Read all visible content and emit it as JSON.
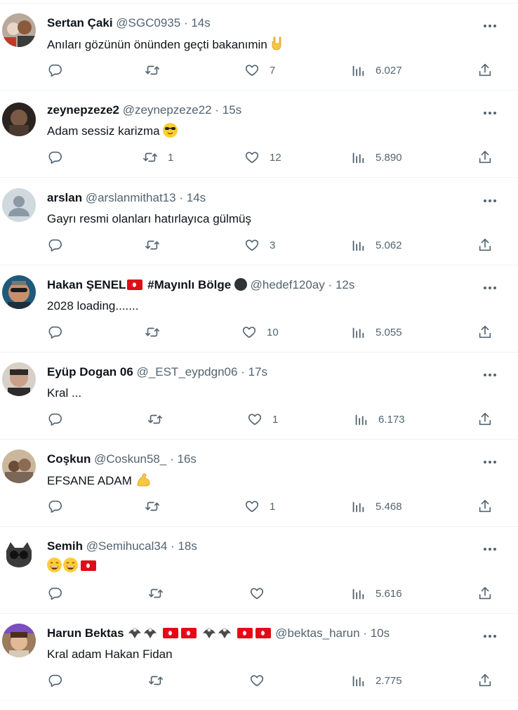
{
  "tweets": [
    {
      "name": "Sertan Çaki",
      "handle": "@SGC0935",
      "time": "14s",
      "text": "Anıları gözünün önünden geçti bakanımin",
      "emoji": "🤘",
      "reply": "",
      "retweet": "",
      "like": "7",
      "views": "6.027"
    },
    {
      "name": "zeynepzeze2",
      "handle": "@zeynepzeze22",
      "time": "15s",
      "text": "Adam sessiz karizma",
      "emoji": "😎",
      "reply": "",
      "retweet": "1",
      "like": "12",
      "views": "5.890"
    },
    {
      "name": "arslan",
      "handle": "@arslanmithat13",
      "time": "14s",
      "text": "Gayrı resmi olanları hatırlayıca gülmüş",
      "emoji": "",
      "reply": "",
      "retweet": "",
      "like": "3",
      "views": "5.062"
    },
    {
      "name": "Hakan ŞENEL",
      "name_suffix": "#Mayınlı Bölge",
      "handle": "@hedef120ay",
      "time": "12s",
      "text": "2028 loading.......",
      "emoji": "",
      "reply": "",
      "retweet": "",
      "like": "10",
      "views": "5.055"
    },
    {
      "name": "Eyüp Dogan 06",
      "handle": "@_EST_eypdgn06",
      "time": "17s",
      "text": "Kral ...",
      "emoji": "",
      "reply": "",
      "retweet": "",
      "like": "1",
      "views": "6.173"
    },
    {
      "name": "Coşkun",
      "handle": "@Coskun58_",
      "time": "16s",
      "text": "EFSANE ADAM",
      "emoji": "💪",
      "reply": "",
      "retweet": "",
      "like": "1",
      "views": "5.468"
    },
    {
      "name": "Semih",
      "handle": "@Semihucal34",
      "time": "18s",
      "text": "",
      "emoji": "😄😄",
      "reply": "",
      "retweet": "",
      "like": "",
      "views": "5.616"
    },
    {
      "name": "Harun Bektas",
      "handle": "@bektas_harun",
      "time": "10s",
      "text": "Kral adam Hakan Fidan",
      "emoji": "",
      "reply": "",
      "retweet": "",
      "like": "",
      "views": "2.775"
    }
  ],
  "separator": "·",
  "icons": [
    "reply-icon",
    "retweet-icon",
    "like-icon",
    "views-icon",
    "share-icon",
    "more-icon"
  ],
  "colors": {
    "text": "#0f1419",
    "muted": "#536471",
    "border": "#eff3f4",
    "flag": "#e30a17"
  }
}
